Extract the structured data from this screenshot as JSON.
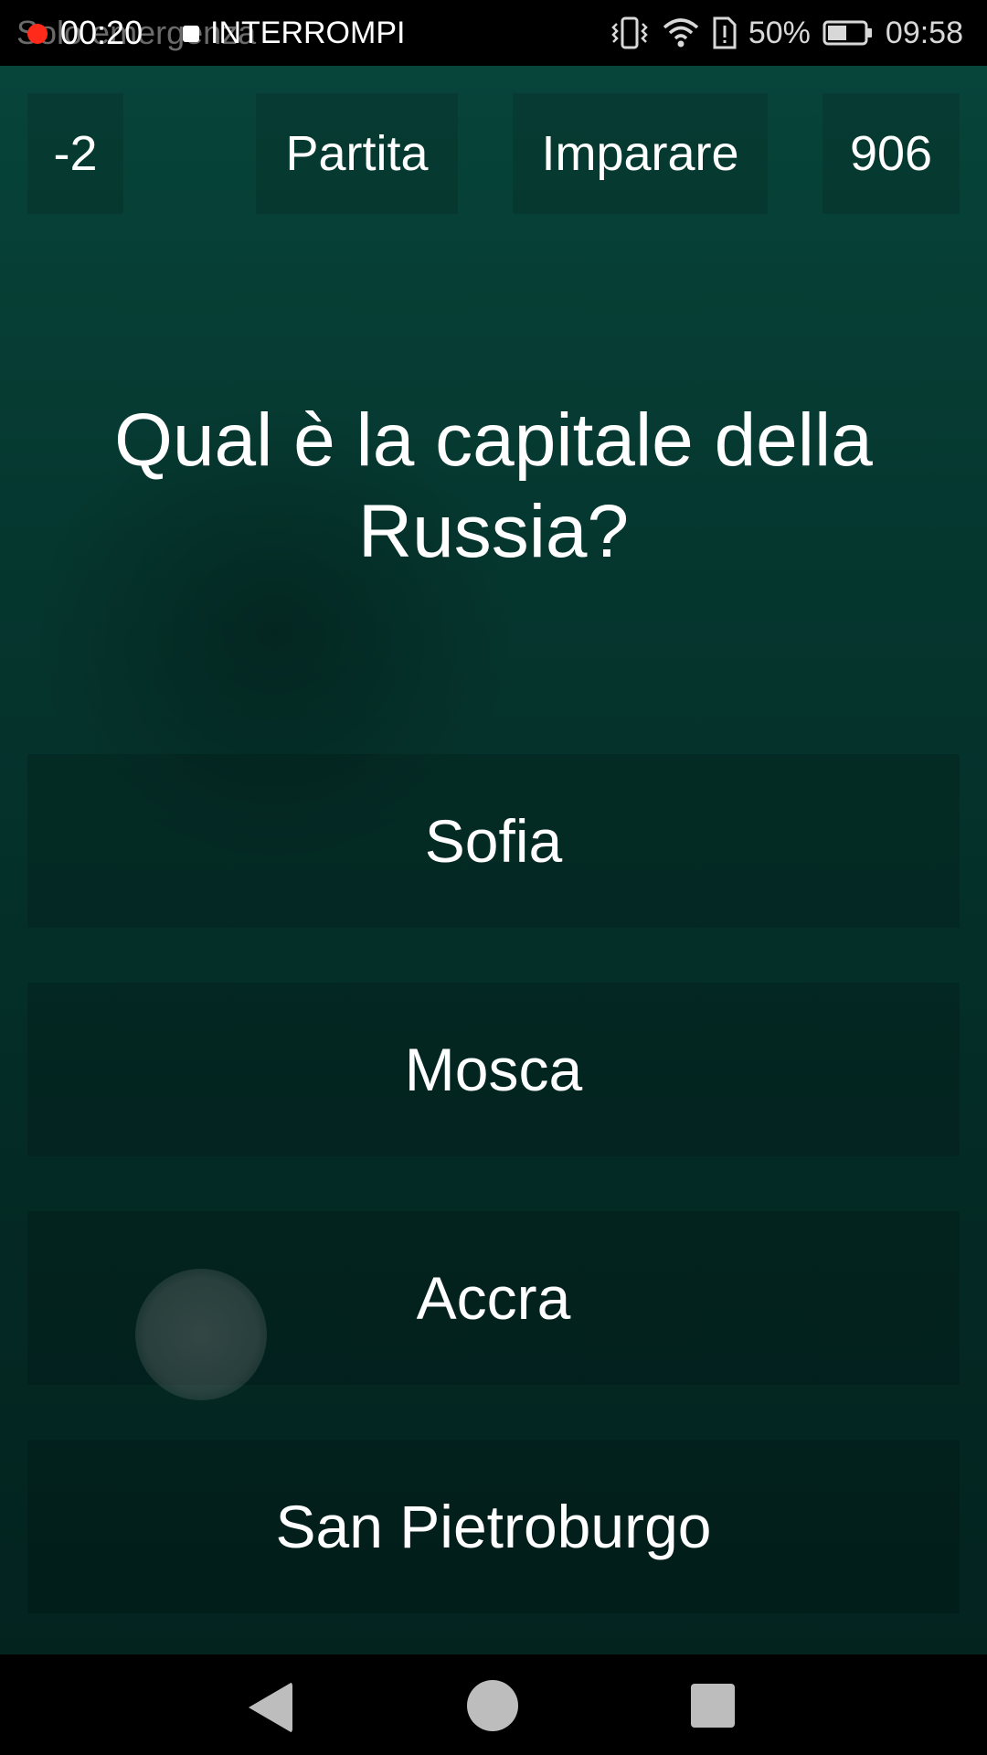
{
  "status_bar": {
    "background_label": "Solo emergenza",
    "recording_time": "00:20",
    "stop_label": "INTERROMPI",
    "battery_percent": "50%",
    "clock": "09:58",
    "icons": [
      "vibrate-icon",
      "wifi-icon",
      "sim-alert-icon",
      "battery-icon"
    ]
  },
  "top_bar": {
    "score_delta": "-2",
    "match_label": "Partita",
    "learn_label": "Imparare",
    "points": "906"
  },
  "quiz": {
    "question": "Qual è la capitale della Russia?",
    "answers": [
      {
        "label": "Sofia"
      },
      {
        "label": "Mosca"
      },
      {
        "label": "Accra"
      },
      {
        "label": "San Pietroburgo"
      }
    ]
  },
  "navigation": {
    "icons": [
      "back-icon",
      "home-icon",
      "recents-icon"
    ]
  },
  "colors": {
    "background_top": "#07443a",
    "background_bottom": "#03231f",
    "text": "#ffffff",
    "record_dot": "#ff2a1a"
  }
}
